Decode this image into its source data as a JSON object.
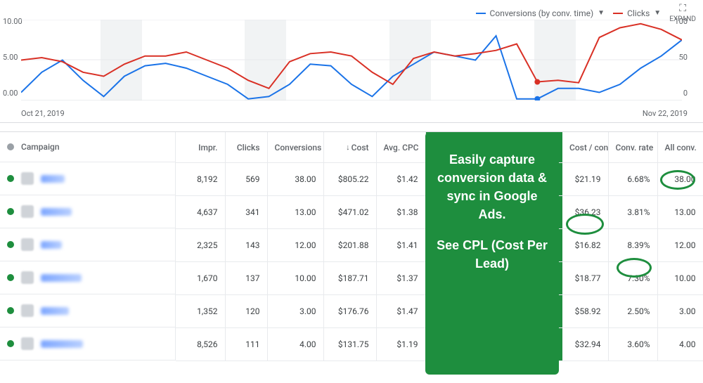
{
  "chart": {
    "legend": {
      "series_a": "Conversions (by conv. time)",
      "series_b": "Clicks"
    },
    "expand_label": "EXPAND",
    "y_left": [
      "10.00",
      "5.00",
      "0.00"
    ],
    "y_right": [
      "100",
      "50",
      "0"
    ],
    "x_start": "Oct 21, 2019",
    "x_end": "Nov 22, 2019"
  },
  "chart_data": {
    "type": "line",
    "x_range": [
      "Oct 21, 2019",
      "Nov 22, 2019"
    ],
    "left_axis": {
      "label": "Conversions (by conv. time)",
      "ylim": [
        0,
        10
      ]
    },
    "right_axis": {
      "label": "Clicks",
      "ylim": [
        0,
        100
      ]
    },
    "series": [
      {
        "name": "Conversions (by conv. time)",
        "axis": "left",
        "color": "#1a73e8",
        "values": [
          1.0,
          3.5,
          5.0,
          2.5,
          0.5,
          3.0,
          4.3,
          4.6,
          4.0,
          3.0,
          2.0,
          0.2,
          0.5,
          2.0,
          4.5,
          4.3,
          2.0,
          0.5,
          3.0,
          4.5,
          6.0,
          5.5,
          5.0,
          8.0,
          0.2,
          0.2,
          1.5,
          1.5,
          1.0,
          2.0,
          4.0,
          5.5,
          7.5
        ]
      },
      {
        "name": "Clicks",
        "axis": "right",
        "color": "#d93025",
        "values": [
          50,
          53,
          48,
          35,
          30,
          45,
          55,
          55,
          60,
          50,
          40,
          25,
          15,
          48,
          58,
          60,
          55,
          35,
          20,
          52,
          60,
          55,
          58,
          62,
          70,
          23,
          25,
          22,
          78,
          90,
          95,
          88,
          75
        ]
      }
    ]
  },
  "headers": {
    "campaign": "Campaign",
    "impr": "Impr.",
    "clicks": "Clicks",
    "conversions": "Conversions",
    "cost": "Cost",
    "avg_cpc": "Avg. CPC",
    "cost_conv": "Cost / conv.",
    "conv_rate": "Conv. rate",
    "all_conv": "All conv."
  },
  "rows": [
    {
      "impr": "8,192",
      "clicks": "569",
      "conversions": "38.00",
      "cost": "$805.22",
      "avg_cpc": "$1.42",
      "cost_conv": "$21.19",
      "conv_rate": "6.68%",
      "all_conv": "38.00"
    },
    {
      "impr": "4,637",
      "clicks": "341",
      "conversions": "13.00",
      "cost": "$471.02",
      "avg_cpc": "$1.38",
      "cost_conv": "$36.23",
      "conv_rate": "3.81%",
      "all_conv": "13.00"
    },
    {
      "impr": "2,325",
      "clicks": "143",
      "conversions": "12.00",
      "cost": "$201.88",
      "avg_cpc": "$1.41",
      "cost_conv": "$16.82",
      "conv_rate": "8.39%",
      "all_conv": "12.00"
    },
    {
      "impr": "1,670",
      "clicks": "137",
      "conversions": "10.00",
      "cost": "$187.71",
      "avg_cpc": "$1.37",
      "cost_conv": "$18.77",
      "conv_rate": "7.30%",
      "all_conv": "10.00"
    },
    {
      "impr": "1,352",
      "clicks": "120",
      "conversions": "3.00",
      "cost": "$176.76",
      "avg_cpc": "$1.47",
      "cost_conv": "$58.92",
      "conv_rate": "2.50%",
      "all_conv": "3.00"
    },
    {
      "impr": "8,526",
      "clicks": "111",
      "conversions": "4.00",
      "cost": "$131.75",
      "avg_cpc": "$1.19",
      "cost_conv": "$32.94",
      "conv_rate": "3.60%",
      "all_conv": "4.00"
    }
  ],
  "callout": {
    "line1": "Easily capture conversion data & sync in Google Ads.",
    "line2": "See CPL (Cost Per Lead)"
  }
}
